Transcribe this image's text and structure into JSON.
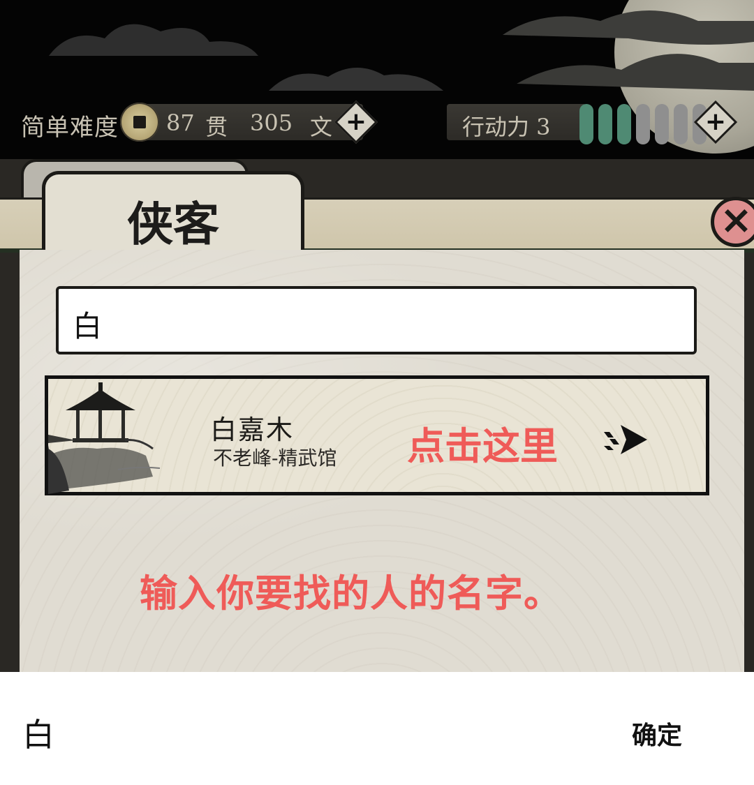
{
  "status_bar": {
    "difficulty": "简单难度",
    "money_guan": "87",
    "money_guan_unit": "贯",
    "money_wen": "305",
    "money_wen_unit": "文",
    "action_label": "行动力 3",
    "energy_total": 7,
    "energy_filled": 3,
    "energy_color_filled": "#4f8a73",
    "energy_color_empty": "#8f8f8f"
  },
  "panel": {
    "tab_title": "侠客",
    "close_icon": "close-icon"
  },
  "search": {
    "value": "白"
  },
  "results": [
    {
      "name": "白嘉木",
      "location": "不老峰-精武馆",
      "icon": "pavilion-image"
    }
  ],
  "annotations": {
    "click_here": "点击这里",
    "hint": "输入你要找的人的名字。",
    "color": "#ef5b58"
  },
  "ime": {
    "composing_text": "白",
    "confirm_label": "确定"
  }
}
